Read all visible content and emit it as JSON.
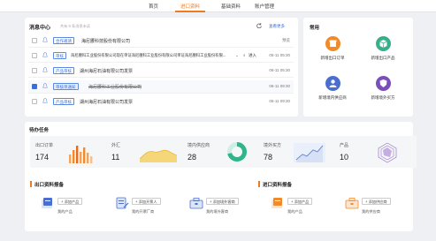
{
  "nav": {
    "tabs": [
      "首页",
      "进口资料",
      "基础资料",
      "账户管理"
    ],
    "active": 1
  },
  "messages": {
    "title": "消息中心",
    "subtitle": "共有 8 条消息未读",
    "refresh_icon": "refresh-icon",
    "view_more": "查看更多",
    "rows": [
      {
        "checked": false,
        "tag": "合作邀请",
        "tag_filled": false,
        "text": "海尼腰科技股份有限公司",
        "strike": false,
        "time": "预览"
      },
      {
        "checked": false,
        "tag": "审核",
        "tag_filled": false,
        "text": "海尼腰科工业股份有限公司现在单证海尼腰科工业股份有限公司单证海尼腰科工业股份有限...",
        "strike": false,
        "time": "05-11 05:30",
        "action": "进入"
      },
      {
        "checked": false,
        "tag": "产品审核",
        "tag_filled": false,
        "text": "湖州海尼石油有限公司发票",
        "strike": false,
        "time": "06-11 05:30"
      },
      {
        "checked": true,
        "tag": "审核单通知",
        "tag_filled": true,
        "text": "海尼腰科工业股份有限公司",
        "strike": true,
        "time": "06-11 09:30"
      },
      {
        "checked": false,
        "tag": "产品审核",
        "tag_filled": false,
        "text": "湖州海尼石油有限公司发票",
        "strike": false,
        "time": "06-11 09:30"
      }
    ]
  },
  "quick": {
    "title": "常用",
    "items": [
      {
        "label": "新增出口订单",
        "color": "#f08a2a",
        "icon": "box-icon"
      },
      {
        "label": "新增出口产品",
        "color": "#36b08a",
        "icon": "cube-icon"
      },
      {
        "label": "新增境内供应商",
        "color": "#4a6fd0",
        "icon": "user-icon"
      },
      {
        "label": "新增境外买方",
        "color": "#7a4fb8",
        "icon": "shield-icon"
      }
    ]
  },
  "tasks": {
    "title": "待办任务",
    "stats": [
      {
        "label": "出口订单",
        "value": "174",
        "icon": "bar-chart-icon"
      },
      {
        "label": "外汇",
        "value": "11",
        "icon": "area-chart-icon"
      },
      {
        "label": "境内供应商",
        "value": "28",
        "icon": "donut-chart-icon"
      },
      {
        "label": "境外买方",
        "value": "78",
        "icon": "line-chart-icon"
      },
      {
        "label": "产品",
        "value": "10",
        "icon": "polygon-icon"
      }
    ]
  },
  "export_section": {
    "title": "出口资料报备",
    "tiles": [
      {
        "button": "+ 添加产品",
        "caption": "我的产品",
        "icon": "product-icon"
      },
      {
        "button": "+ 添加开票人",
        "caption": "我的开票厂商",
        "icon": "invoice-icon"
      },
      {
        "button": "+ 添加境外客商",
        "caption": "我的境外客商",
        "icon": "briefcase-icon"
      }
    ]
  },
  "import_section": {
    "title": "进口资料报备",
    "tiles": [
      {
        "button": "+ 添加产品",
        "caption": "我的产品",
        "icon": "product-icon"
      },
      {
        "button": "+ 添加供应商",
        "caption": "我的供应商",
        "icon": "briefcase-icon"
      }
    ]
  }
}
